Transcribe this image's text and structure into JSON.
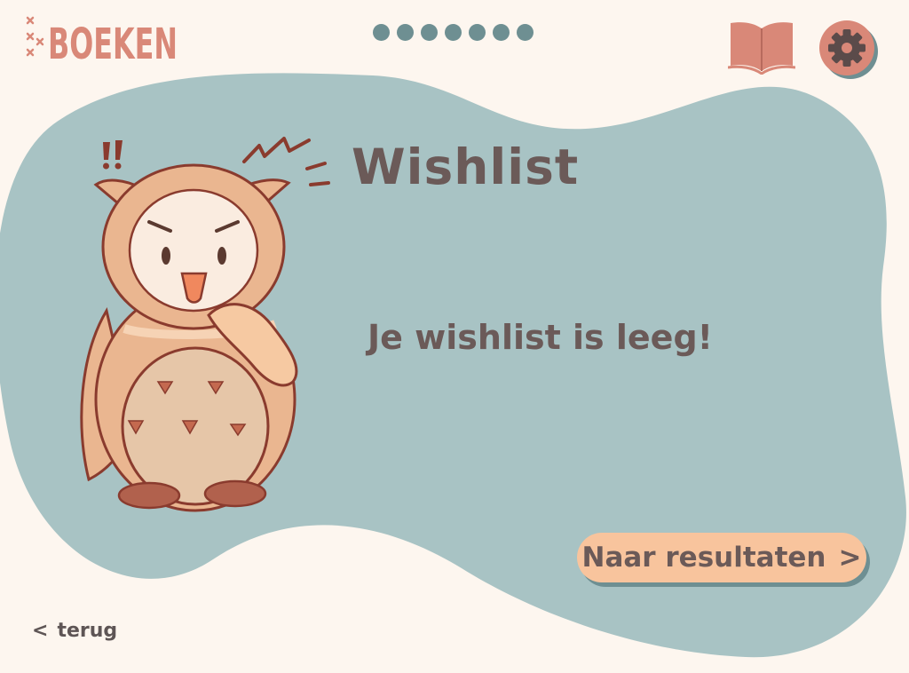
{
  "colors": {
    "background": "#fdf6ef",
    "blob": "#a8c3c4",
    "accent": "#d98878",
    "text": "#6b5a58",
    "button": "#f8c49d",
    "dots": "#6e8f92"
  },
  "header": {
    "logo_text": "BOEKEN",
    "progress_dot_count": 7,
    "book_icon": "open-book-icon",
    "settings_icon": "gear-icon"
  },
  "main": {
    "title": "Wishlist",
    "empty_message": "Je wishlist is leeg!",
    "results_button_label": "Naar resultaten",
    "results_button_arrow": ">"
  },
  "footer": {
    "back_arrow": "<",
    "back_label": "terug"
  }
}
